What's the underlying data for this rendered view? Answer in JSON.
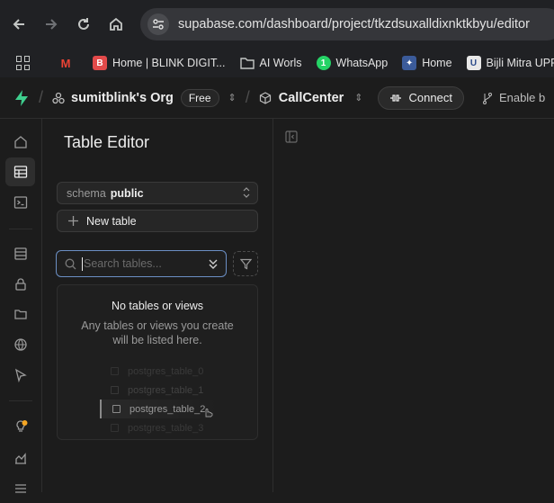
{
  "browser": {
    "url": "supabase.com/dashboard/project/tkzdsuxalldixnktkbyu/editor"
  },
  "bookmarks": [
    {
      "label": "",
      "icon": "gmail-icon"
    },
    {
      "label": "Home | BLINK DIGIT...",
      "icon": "blink-icon"
    },
    {
      "label": "AI Worls",
      "icon": "folder-icon"
    },
    {
      "label": "WhatsApp",
      "icon": "whatsapp-icon"
    },
    {
      "label": "Home",
      "icon": "home-bookmark-icon"
    },
    {
      "label": "Bijli Mitra UPPCL",
      "icon": "uppcl-icon"
    }
  ],
  "header": {
    "org_name": "sumitblink's Org",
    "plan_badge": "Free",
    "project_name": "CallCenter",
    "connect_label": "Connect",
    "enable_label": "Enable b"
  },
  "panel": {
    "title": "Table Editor",
    "schema_label": "schema",
    "schema_value": "public",
    "new_table_label": "New table",
    "search_placeholder": "Search tables...",
    "empty_title": "No tables or views",
    "empty_desc": "Any tables or views you create will be listed here.",
    "ghost_tables": [
      "postgres_table_0",
      "postgres_table_1",
      "postgres_table_2",
      "postgres_table_3"
    ]
  },
  "colors": {
    "brand_green": "#3ecf8e",
    "accent_focus": "#6b8fc4",
    "background": "#1c1c1c"
  }
}
